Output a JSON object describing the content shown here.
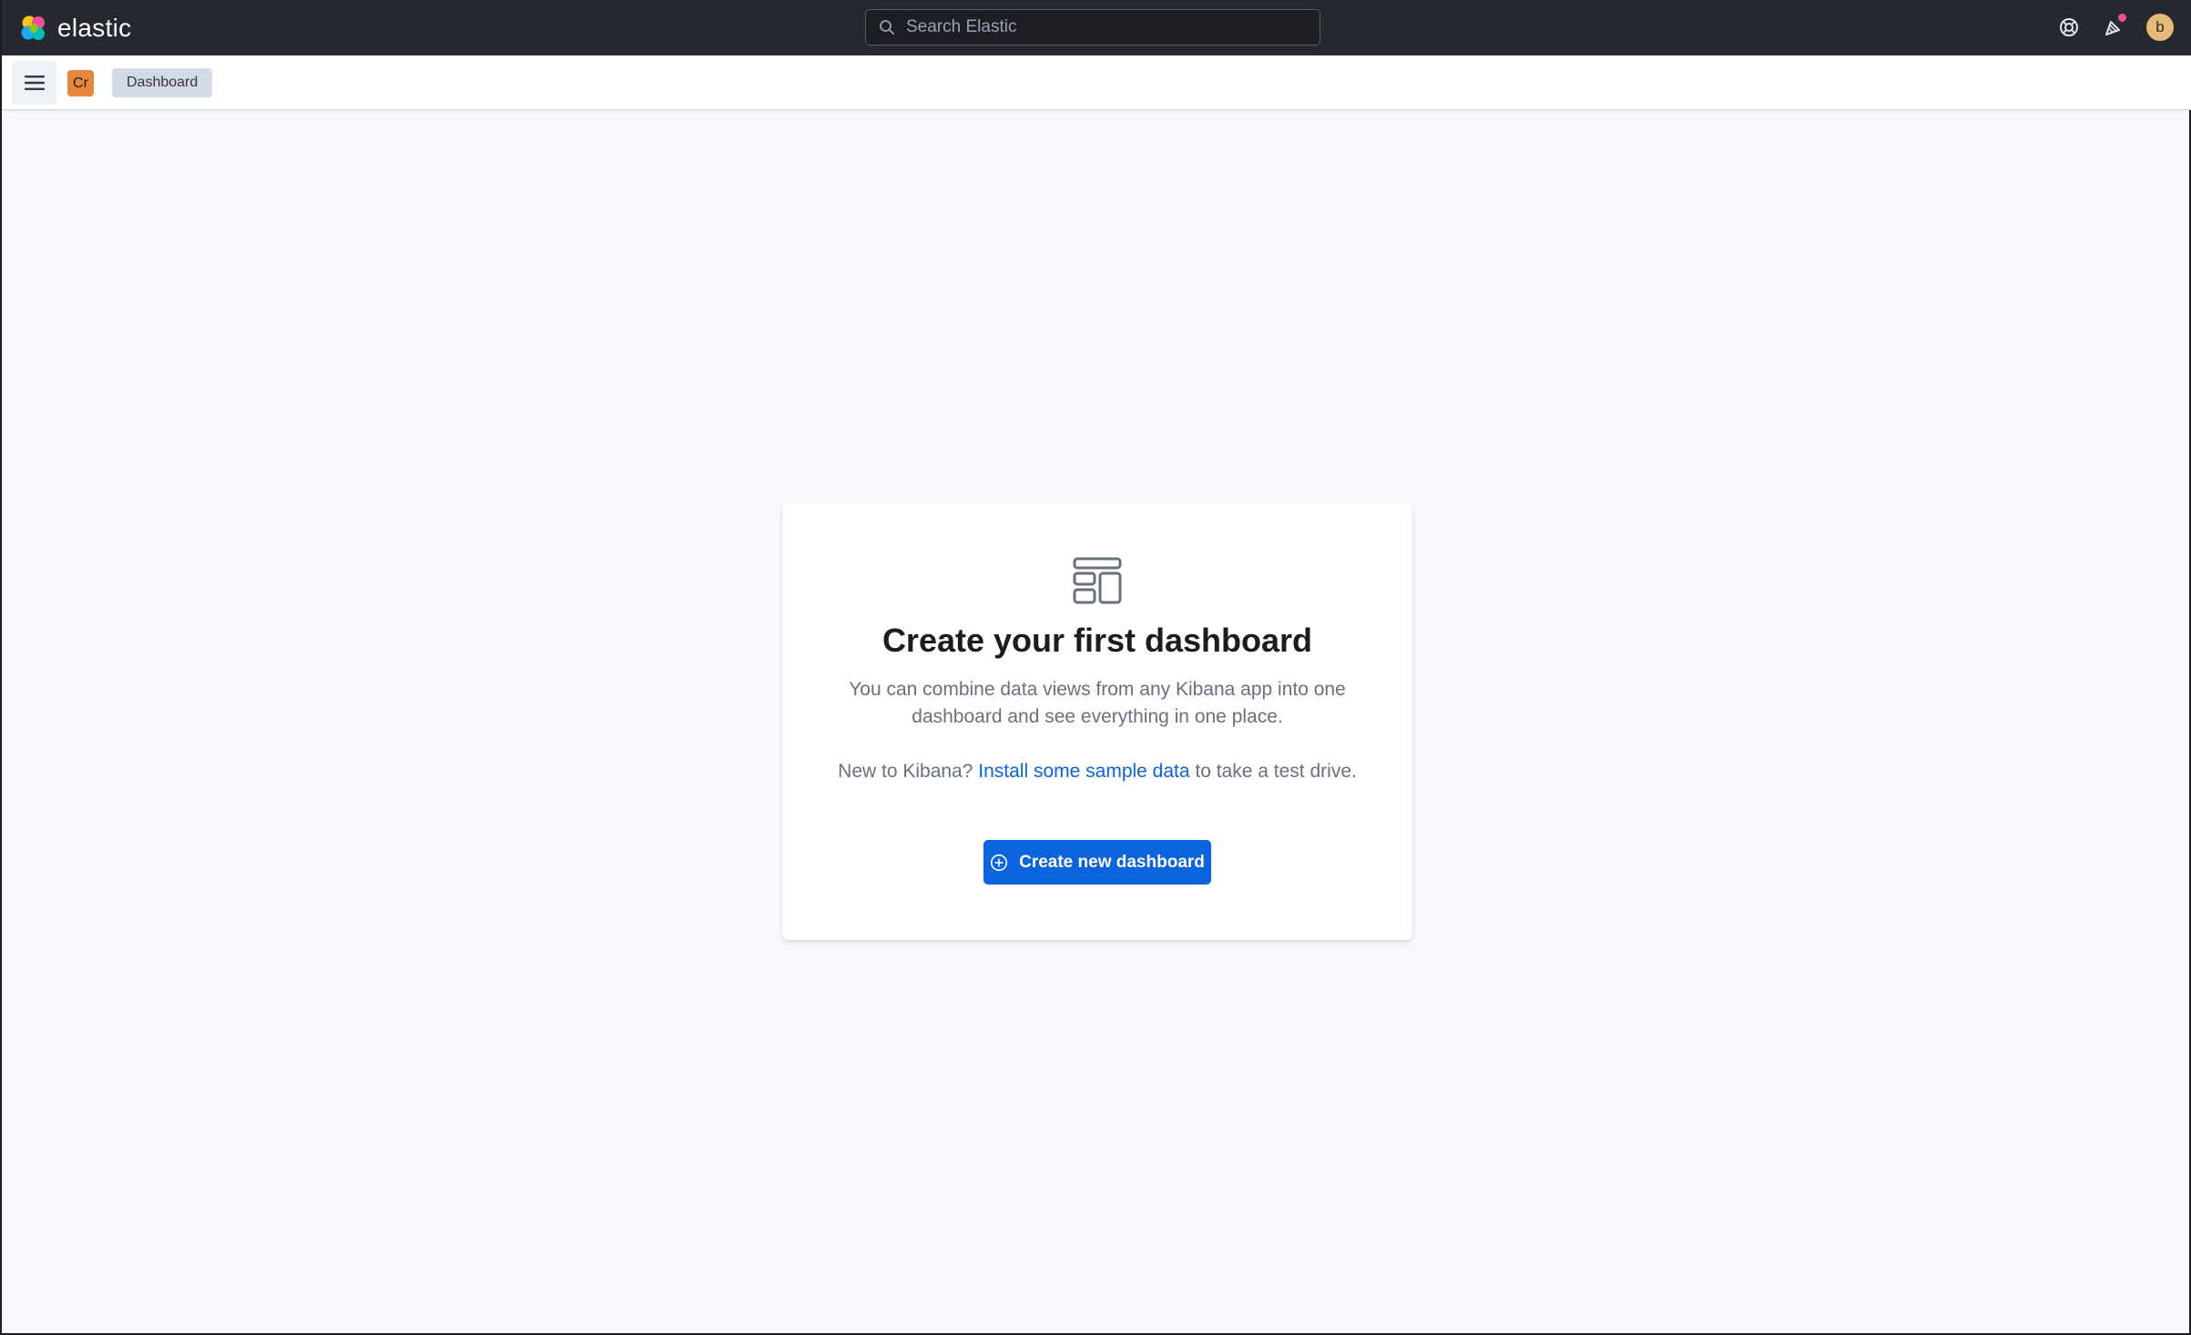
{
  "header": {
    "brand": "elastic",
    "search": {
      "placeholder": "Search Elastic",
      "value": ""
    },
    "icons": [
      "help-icon",
      "newsfeed-icon",
      "user-avatar"
    ],
    "avatar_initial": "b",
    "colors": {
      "header_bg": "#25282f",
      "notification_dot": "#f04e98",
      "avatar": "#e4b97a"
    }
  },
  "subheader": {
    "menu_icon": "hamburger-menu-icon",
    "space_badge": "Cr",
    "breadcrumb": "Dashboard",
    "colors": {
      "space_badge": "#e7873b"
    }
  },
  "empty_state": {
    "icon": "dashboard-app-icon",
    "title": "Create your first dashboard",
    "body": "You can combine data views from any Kibana app into one dashboard and see everything in one place.",
    "prompt_before": "New to Kibana?",
    "link_text": "Install some sample data",
    "prompt_after": "to take a test drive.",
    "button_label": "Create new dashboard",
    "colors": {
      "primary": "#0b64dd"
    }
  }
}
